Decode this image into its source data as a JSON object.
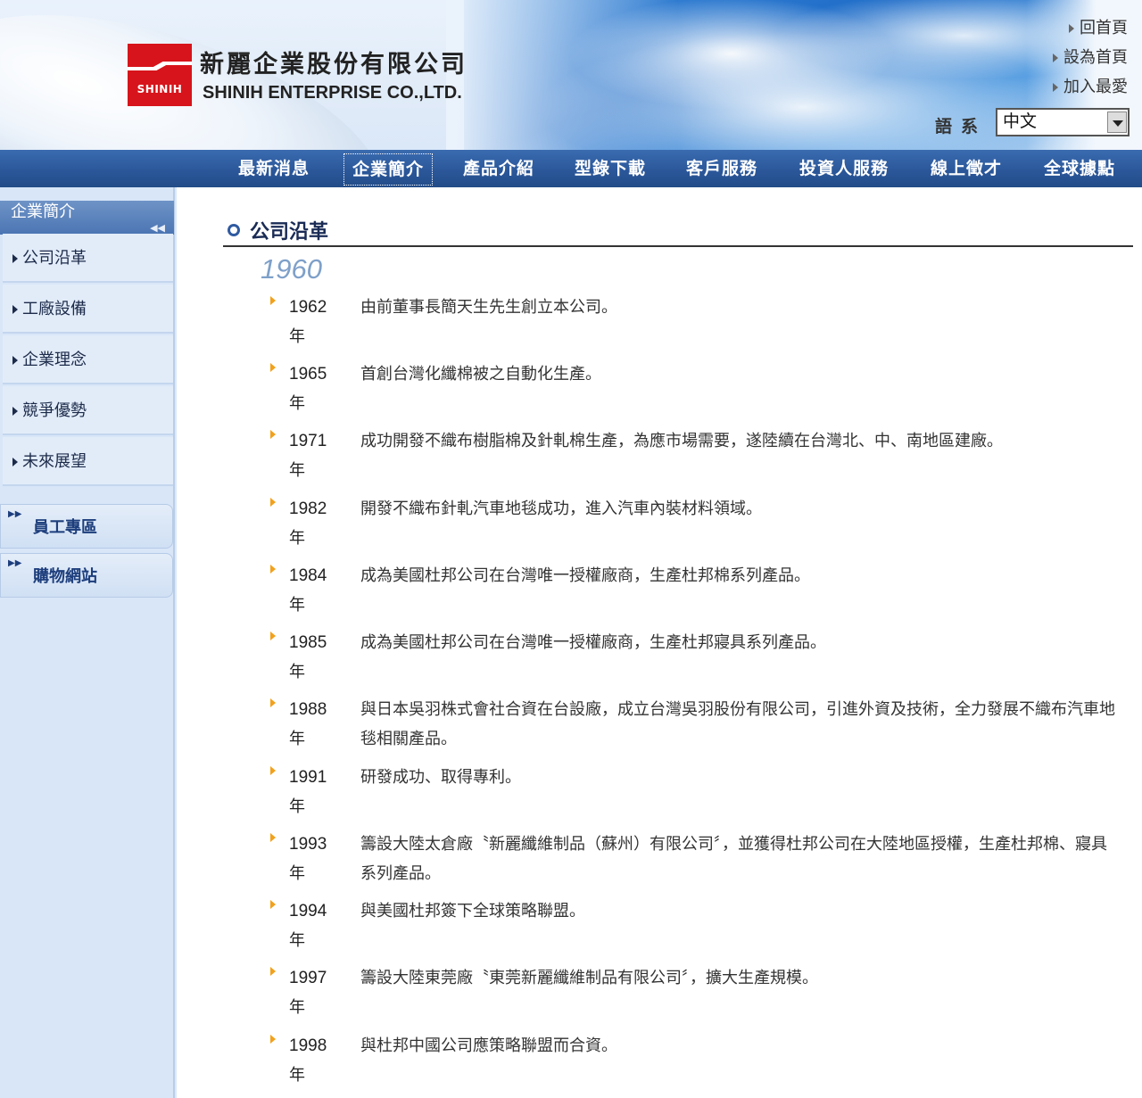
{
  "header": {
    "logo_text": "SHINIH",
    "company_cn": "新麗企業股份有限公司",
    "company_en": "SHINIH ENTERPRISE CO.,LTD.",
    "top_links": [
      "回首頁",
      "設為首頁",
      "加入最愛"
    ],
    "language_label": "語系",
    "language_selected": "中文"
  },
  "nav": {
    "items": [
      "最新消息",
      "企業簡介",
      "產品介紹",
      "型錄下載",
      "客戶服務",
      "投資人服務",
      "線上徵才",
      "全球據點"
    ],
    "active": "企業簡介"
  },
  "sidebar": {
    "heading": "企業簡介",
    "items": [
      "公司沿革",
      "工廠設備",
      "企業理念",
      "競爭優勢",
      "未來展望"
    ],
    "boxes": [
      "員工專區",
      "購物網站"
    ]
  },
  "content": {
    "title": "公司沿革",
    "decade": "1960",
    "year_suffix": "年",
    "events": [
      {
        "year": "1962",
        "desc": "由前董事長簡天生先生創立本公司。"
      },
      {
        "year": "1965",
        "desc": "首創台灣化纖棉被之自動化生產。"
      },
      {
        "year": "1971",
        "desc": "成功開發不織布樹脂棉及針軋棉生產，為應市場需要，遂陸續在台灣北、中、南地區建廠。"
      },
      {
        "year": "1982",
        "desc": "開發不織布針軋汽車地毯成功，進入汽車內裝材料領域。"
      },
      {
        "year": "1984",
        "desc": "成為美國杜邦公司在台灣唯一授權廠商，生產杜邦棉系列產品。"
      },
      {
        "year": "1985",
        "desc": "成為美國杜邦公司在台灣唯一授權廠商，生產杜邦寢具系列產品。"
      },
      {
        "year": "1988",
        "desc": "與日本吳羽株式會社合資在台設廠，成立台灣吳羽股份有限公司，引進外資及技術，全力發展不織布汽車地毯相關產品。"
      },
      {
        "year": "1991",
        "desc": "研發成功、取得專利。"
      },
      {
        "year": "1993",
        "desc": "籌設大陸太倉廠〝新麗纖維制品（蘇州）有限公司〞，並獲得杜邦公司在大陸地區授權，生產杜邦棉、寢具系列產品。"
      },
      {
        "year": "1994",
        "desc": "與美國杜邦簽下全球策略聯盟。"
      },
      {
        "year": "1997",
        "desc": "籌設大陸東莞廠〝東莞新麗纖維制品有限公司〞，擴大生產規模。"
      },
      {
        "year": "1998",
        "desc": "與杜邦中國公司應策略聯盟而合資。"
      }
    ]
  }
}
